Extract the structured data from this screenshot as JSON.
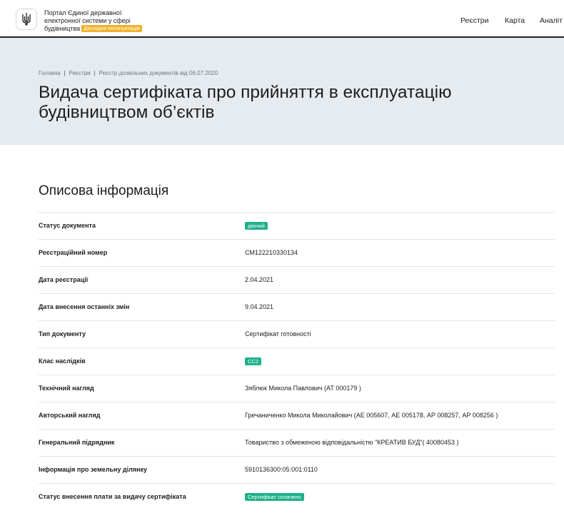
{
  "header": {
    "logo_lines": [
      "Портал Єдиної державної",
      "електронної системи у сфері",
      "будівництва"
    ],
    "badge": "Дослідна експлуатація",
    "nav": [
      "Реєстри",
      "Карта",
      "Аналіт"
    ]
  },
  "breadcrumb": [
    "Головна",
    "Реєстри",
    "Реєстр дозвільних документів від 06.07.2020"
  ],
  "title_lines": [
    "Видача сертифіката про прийняття в експлуатацію",
    "будівництвом об’єктів"
  ],
  "section_title": "Описова інформація",
  "rows": [
    {
      "label": "Статус документа",
      "value": "діючий",
      "pill": true
    },
    {
      "label": "Реєстраційний номер",
      "value": "СМ122210330134",
      "pill": false
    },
    {
      "label": "Дата реєстрації",
      "value": "2.04.2021",
      "pill": false
    },
    {
      "label": "Дата внесення останніх змін",
      "value": "9.04.2021",
      "pill": false
    },
    {
      "label": "Тип документу",
      "value": "Сертифікат готовності",
      "pill": false
    },
    {
      "label": "Клас наслідків",
      "value": "СС2",
      "pill": true
    },
    {
      "label": "Технічний нагляд",
      "value": "Зяблюк Микола Павлович (АТ 000179 )",
      "pill": false
    },
    {
      "label": "Авторський нагляд",
      "value": "Гречаниченко Микола Миколайович (АЕ 005607, АЕ 005178, АР 008257, АР 008256 )",
      "pill": false
    },
    {
      "label": "Генеральний підрядник",
      "value": "Товариство з обмеженою відповідальністю \"КРЕАТИВ БУД\"( 40080453 )",
      "pill": false
    },
    {
      "label": "Інформація про земельну ділянку",
      "value": "5910136300:05:001:0110",
      "pill": false
    },
    {
      "label": "Статус внесення плати за видачу сертифіката",
      "value": "Сертифікат сплачено",
      "pill": true
    }
  ],
  "colors": {
    "accent_badge": "#f0b12a",
    "status_pill": "#1fb08a",
    "hero_bg": "#e6ebf0"
  }
}
